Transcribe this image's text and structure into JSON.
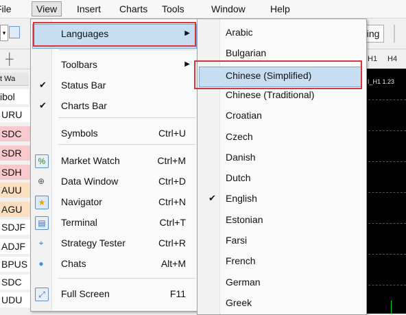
{
  "menubar": {
    "items": [
      {
        "label": "File",
        "active": false
      },
      {
        "label": "View",
        "active": true
      },
      {
        "label": "Insert",
        "active": false
      },
      {
        "label": "Charts",
        "active": false
      },
      {
        "label": "Tools",
        "active": false
      },
      {
        "label": "Window",
        "active": false
      },
      {
        "label": "Help",
        "active": false
      }
    ]
  },
  "toolbar": {
    "trading_label": "ding",
    "timeframes": [
      "H1",
      "H4"
    ]
  },
  "market_watch": {
    "header": "t Wa",
    "column_header": "ibol",
    "symbols": [
      {
        "text": "URU",
        "bg": "#ffffff"
      },
      {
        "text": "SDC",
        "bg": "#f7c9cc"
      },
      {
        "text": "SDR",
        "bg": "#f7c9cc"
      },
      {
        "text": "SDH",
        "bg": "#f7c9cc"
      },
      {
        "text": "AUU",
        "bg": "#f9dfc0"
      },
      {
        "text": "AGU",
        "bg": "#f9dfc0"
      },
      {
        "text": "SDJF",
        "bg": "#ffffff"
      },
      {
        "text": "ADJF",
        "bg": "#ffffff"
      },
      {
        "text": "BPUS",
        "bg": "#ffffff"
      },
      {
        "text": "SDC",
        "bg": "#ffffff"
      },
      {
        "text": "UDU",
        "bg": "#ffffff"
      }
    ]
  },
  "chart": {
    "label": "I_H1 1.23"
  },
  "view_menu": {
    "items": [
      {
        "label": "Languages",
        "shortcut": "",
        "check": false,
        "submenu": true,
        "icon": "",
        "highlighted": true
      },
      {
        "label": "Toolbars",
        "shortcut": "",
        "check": false,
        "submenu": true,
        "icon": ""
      },
      {
        "label": "Status Bar",
        "shortcut": "",
        "check": true,
        "submenu": false,
        "icon": ""
      },
      {
        "label": "Charts Bar",
        "shortcut": "",
        "check": true,
        "submenu": false,
        "icon": ""
      },
      {
        "label": "Symbols",
        "shortcut": "Ctrl+U",
        "check": false,
        "submenu": false,
        "icon": ""
      },
      {
        "label": "Market Watch",
        "shortcut": "Ctrl+M",
        "check": false,
        "submenu": false,
        "icon": "market-watch-icon"
      },
      {
        "label": "Data Window",
        "shortcut": "Ctrl+D",
        "check": false,
        "submenu": false,
        "icon": "crosshair-icon"
      },
      {
        "label": "Navigator",
        "shortcut": "Ctrl+N",
        "check": false,
        "submenu": false,
        "icon": "navigator-star-icon"
      },
      {
        "label": "Terminal",
        "shortcut": "Ctrl+T",
        "check": false,
        "submenu": false,
        "icon": "terminal-icon"
      },
      {
        "label": "Strategy Tester",
        "shortcut": "Ctrl+R",
        "check": false,
        "submenu": false,
        "icon": "strategy-tester-icon"
      },
      {
        "label": "Chats",
        "shortcut": "Alt+M",
        "check": false,
        "submenu": false,
        "icon": "chat-bubble-icon"
      },
      {
        "label": "Full Screen",
        "shortcut": "F11",
        "check": false,
        "submenu": false,
        "icon": "fullscreen-icon"
      }
    ]
  },
  "languages_submenu": {
    "items": [
      {
        "label": "Arabic",
        "check": false
      },
      {
        "label": "Bulgarian",
        "check": false
      },
      {
        "label": "Chinese (Simplified)",
        "check": false,
        "highlighted": true
      },
      {
        "label": "Chinese (Traditional)",
        "check": false
      },
      {
        "label": "Croatian",
        "check": false
      },
      {
        "label": "Czech",
        "check": false
      },
      {
        "label": "Danish",
        "check": false
      },
      {
        "label": "Dutch",
        "check": false
      },
      {
        "label": "English",
        "check": true
      },
      {
        "label": "Estonian",
        "check": false
      },
      {
        "label": "Farsi",
        "check": false
      },
      {
        "label": "French",
        "check": false
      },
      {
        "label": "German",
        "check": false
      },
      {
        "label": "Greek",
        "check": false
      }
    ]
  },
  "colors": {
    "highlight": "#c7ddf2",
    "annotation_red": "#d9343a"
  }
}
